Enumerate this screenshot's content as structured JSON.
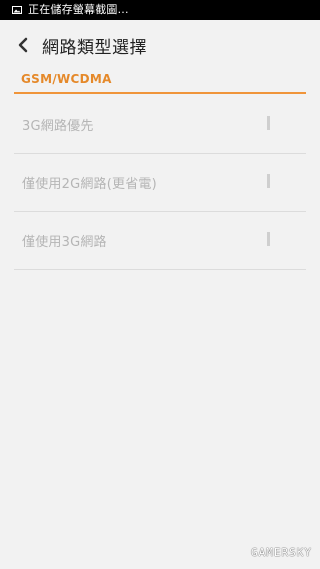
{
  "status_bar": {
    "icon": "screenshot-icon",
    "text": "正在儲存螢幕截圖..."
  },
  "header": {
    "back_icon": "chevron-left-icon",
    "title": "網路類型選擇"
  },
  "section": {
    "label": "GSM/WCDMA"
  },
  "options": [
    {
      "label": "3G網路優先",
      "selected": false
    },
    {
      "label": "僅使用2G網路(更省電)",
      "selected": false
    },
    {
      "label": "僅使用3G網路",
      "selected": false
    }
  ],
  "watermark": "GAMERSKY"
}
